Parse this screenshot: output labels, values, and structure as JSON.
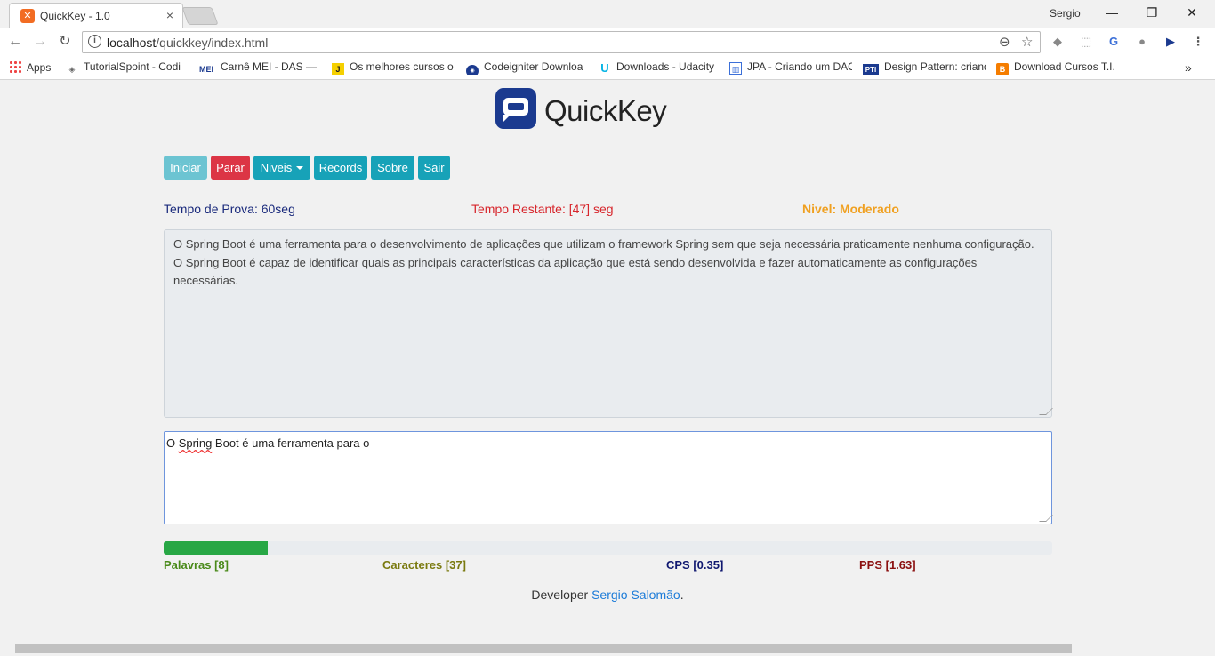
{
  "browser": {
    "tab_title": "QuickKey - 1.0",
    "user": "Sergio",
    "url_host": "localhost",
    "url_path": "/quickkey/index.html",
    "bookmarks": [
      "Apps",
      "TutorialSpoint - Codi",
      "Carnê MEI - DAS — P",
      "Os melhores cursos o",
      "Codeigniter Downloa",
      "Downloads - Udacity",
      "JPA - Criando um DAO",
      "Design Pattern: criand",
      "Download Cursos T.I."
    ],
    "bookmark_icon_texts": [
      "MEI",
      "PTI"
    ]
  },
  "logo": {
    "text": "QuickKey"
  },
  "menu": {
    "iniciar": "Iniciar",
    "parar": "Parar",
    "niveis": "Niveis",
    "records": "Records",
    "sobre": "Sobre",
    "sair": "Sair"
  },
  "status": {
    "tempo_prova": "Tempo de Prova: 60seg",
    "tempo_restante": "Tempo Restante: [47] seg",
    "nivel": "Nivel: Moderado"
  },
  "colors": {
    "tempo_prova": "#1a2a7c",
    "tempo_restante": "#d7262c",
    "nivel": "#f0a020",
    "palavras": "#4a8a1a",
    "caracteres": "#7a7a10",
    "cps": "#101870",
    "pps": "#8b1010"
  },
  "reference_text": "O Spring Boot é uma ferramenta para o desenvolvimento de aplicações que utilizam o framework Spring sem que seja necessária praticamente nenhuma configuração. O Spring Boot é capaz de identificar quais as principais características da aplicação que está sendo desenvolvida e fazer automaticamente as configurações necessárias.",
  "typed": {
    "word1": "O ",
    "misspelled": "Spring",
    "rest": " Boot é uma ferramenta para o"
  },
  "progress_fraction": 0.117,
  "metrics": {
    "palavras": "Palavras [8]",
    "caracteres": "Caracteres [37]",
    "cps": "CPS [0.35]",
    "pps": "PPS [1.63]"
  },
  "footer": {
    "prefix": "Developer ",
    "author": "Sergio Salomão",
    "suffix": "."
  }
}
